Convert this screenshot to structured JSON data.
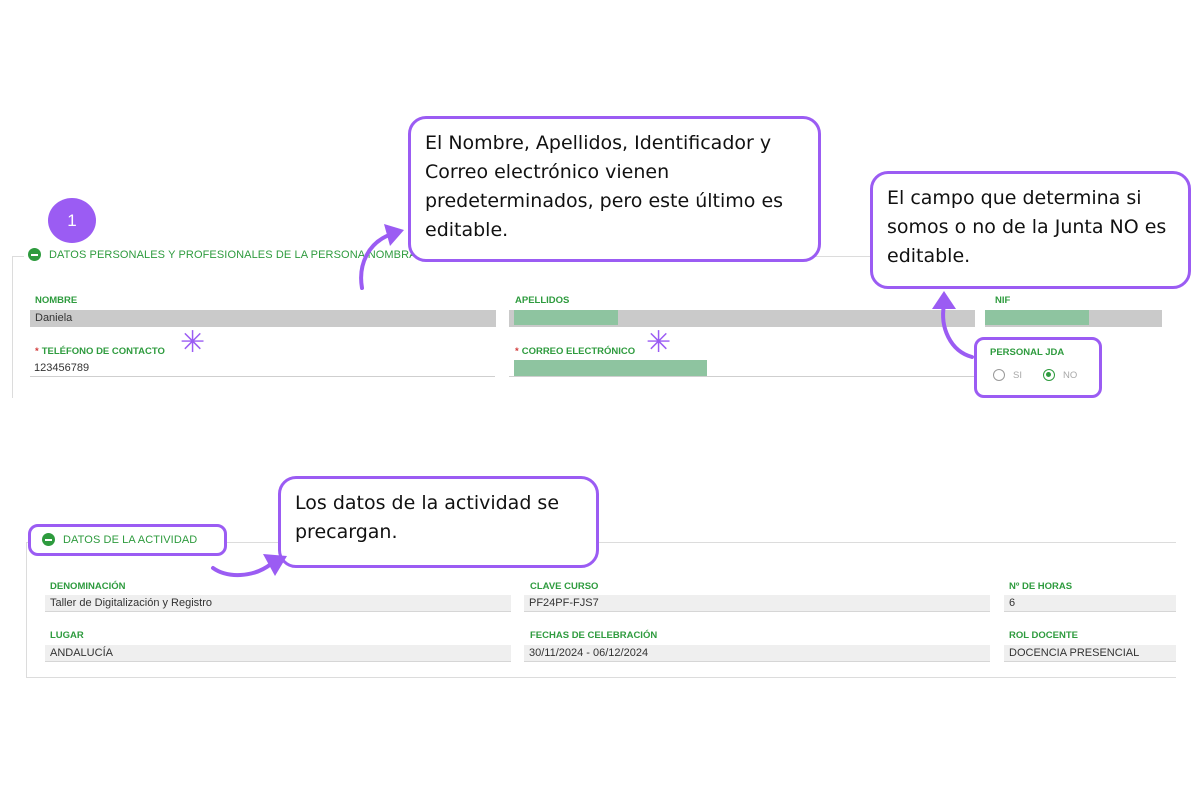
{
  "step": "1",
  "section1": {
    "title": "DATOS PERSONALES Y PROFESIONALES DE LA PERSONA NOMBRADA",
    "nombre_label": "NOMBRE",
    "nombre_value": "Daniela",
    "apellidos_label": "APELLIDOS",
    "nif_label": "NIF",
    "telefono_label": "TELÉFONO DE CONTACTO",
    "telefono_value": "123456789",
    "correo_label": "CORREO ELECTRÓNICO",
    "personal_jda_label": "PERSONAL JDA",
    "radio_si": "SI",
    "radio_no": "NO",
    "selected": "NO",
    "required_mark": "*"
  },
  "section2": {
    "title": "DATOS DE LA ACTIVIDAD",
    "denominacion_label": "DENOMINACIÓN",
    "denominacion_value": "Taller de Digitalización y Registro",
    "clave_label": "CLAVE CURSO",
    "clave_value": "PF24PF-FJS7",
    "horas_label": "Nº DE HORAS",
    "horas_value": "6",
    "lugar_label": "LUGAR",
    "lugar_value": "ANDALUCÍA",
    "fechas_label": "FECHAS DE CELEBRACIÓN",
    "fechas_value": "30/11/2024 - 06/12/2024",
    "rol_label": "ROL DOCENTE",
    "rol_value": "DOCENCIA PRESENCIAL"
  },
  "callouts": {
    "predeterminados": "El Nombre, Apellidos, Identificador y Correo electrónico vienen predeterminados, pero este último es editable.",
    "junta": "El campo que determina si somos o no de la Junta NO es editable.",
    "actividad": "Los datos de la actividad se precargan."
  },
  "colors": {
    "accent_purple": "#9b5cf3",
    "form_green": "#2e9b3e",
    "redaction": "#8ec4a0"
  },
  "icons": [
    "collapse-minus-icon",
    "asterisk-icon",
    "curved-arrow-icon"
  ]
}
